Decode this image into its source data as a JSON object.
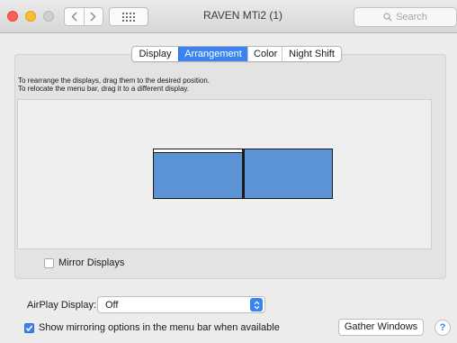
{
  "window": {
    "title": "RAVEN MTi2 (1)",
    "search_placeholder": "Search"
  },
  "tabs": [
    {
      "label": "Display",
      "active": false
    },
    {
      "label": "Arrangement",
      "active": true
    },
    {
      "label": "Color",
      "active": false
    },
    {
      "label": "Night Shift",
      "active": false
    }
  ],
  "arrangement": {
    "instruction_line1": "To rearrange the displays, drag them to the desired position.",
    "instruction_line2": "To relocate the menu bar, drag it to a different display.",
    "displays": [
      "left-display",
      "right-display"
    ],
    "mirror_label": "Mirror Displays",
    "mirror_checked": false
  },
  "airplay": {
    "label": "AirPlay Display:",
    "value": "Off"
  },
  "show_mirroring": {
    "label": "Show mirroring options in the menu bar when available",
    "checked": true
  },
  "gather_label": "Gather Windows",
  "help_label": "?",
  "colors": {
    "accent": "#3b83f1",
    "display_fill": "#5b93d4"
  },
  "icons": {
    "back": "chevron-left-icon",
    "forward": "chevron-right-icon",
    "grid": "grid-icon",
    "search": "magnifier-icon"
  }
}
